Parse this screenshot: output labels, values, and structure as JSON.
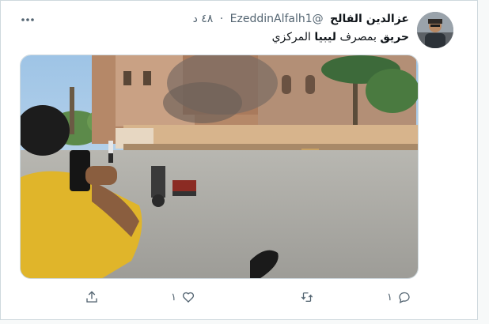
{
  "tweet": {
    "author_name": "عزالدين الفالح",
    "handle": "@EzeddinAlfalh1",
    "separator": "·",
    "time": "٤٨ د",
    "text_bold_1": "حريق",
    "text_1": " بمصرف ",
    "text_bold_2": "ليبيا",
    "text_2": " المركزي"
  },
  "actions": {
    "reply_count": "١",
    "retweet_count": "",
    "like_count": "١",
    "share_count": ""
  },
  "icons": {
    "more": "more-horizontal-icon",
    "reply": "reply-icon",
    "retweet": "retweet-icon",
    "like": "heart-icon",
    "share": "share-icon"
  },
  "colors": {
    "text_primary": "#0f1419",
    "text_secondary": "#536471",
    "border": "#cfd9de"
  }
}
